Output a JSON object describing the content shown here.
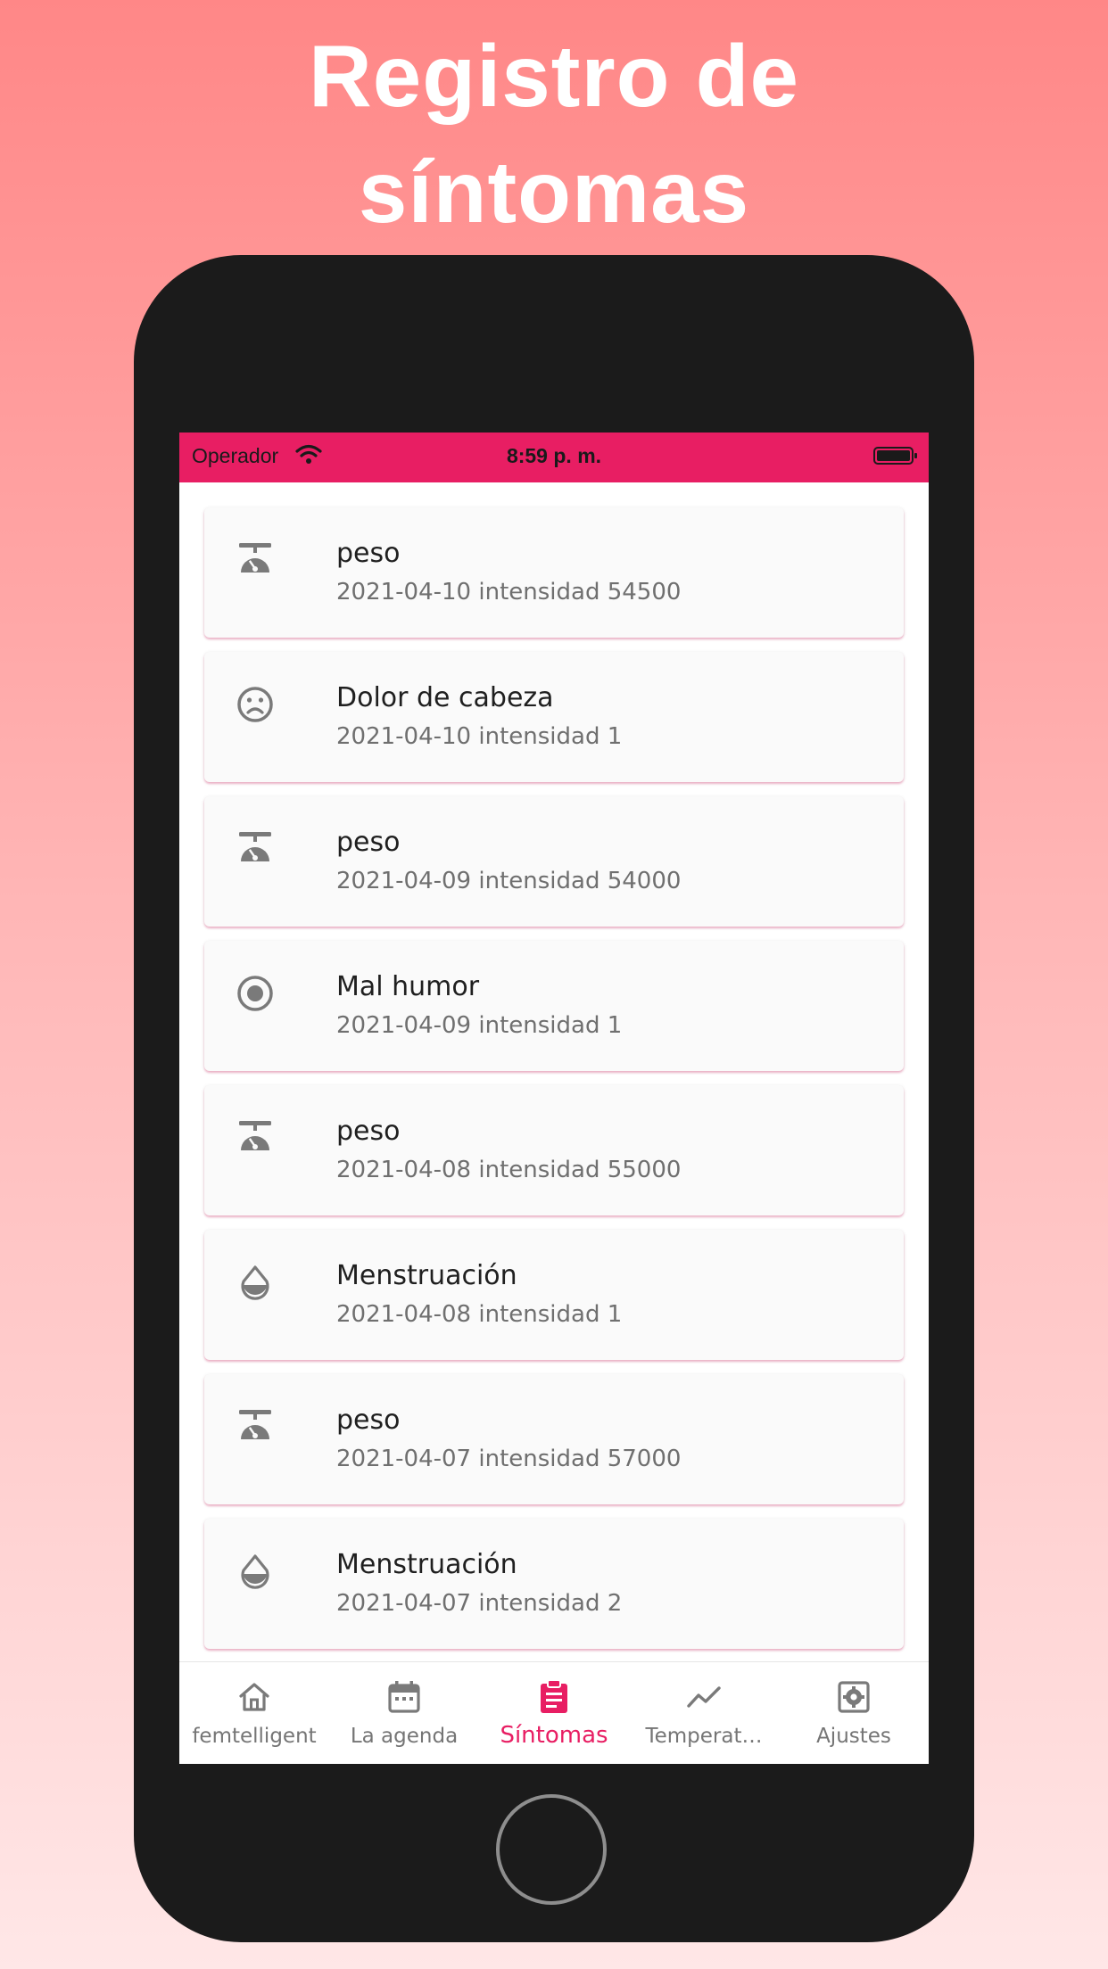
{
  "headline": {
    "line1": "Registro de",
    "line2": "síntomas"
  },
  "status_bar": {
    "carrier": "Operador",
    "time": "8:59 p. m."
  },
  "symptoms": [
    {
      "icon": "scale-icon",
      "title": "peso",
      "subtitle": "2021-04-10 intensidad 54500"
    },
    {
      "icon": "sad-face-icon",
      "title": "Dolor de cabeza",
      "subtitle": "2021-04-10 intensidad 1"
    },
    {
      "icon": "scale-icon",
      "title": "peso",
      "subtitle": "2021-04-09 intensidad 54000"
    },
    {
      "icon": "radio-dot-icon",
      "title": "Mal humor",
      "subtitle": "2021-04-09 intensidad 1"
    },
    {
      "icon": "scale-icon",
      "title": "peso",
      "subtitle": "2021-04-08 intensidad 55000"
    },
    {
      "icon": "drop-icon",
      "title": "Menstruación",
      "subtitle": "2021-04-08 intensidad 1"
    },
    {
      "icon": "scale-icon",
      "title": "peso",
      "subtitle": "2021-04-07 intensidad 57000"
    },
    {
      "icon": "drop-icon",
      "title": "Menstruación",
      "subtitle": "2021-04-07 intensidad 2"
    }
  ],
  "tabs": [
    {
      "label": "femtelligent",
      "icon": "home-icon",
      "active": false
    },
    {
      "label": "La agenda",
      "icon": "calendar-icon",
      "active": false
    },
    {
      "label": "Síntomas",
      "icon": "clipboard-icon",
      "active": true
    },
    {
      "label": "Temperat…",
      "icon": "trend-line-icon",
      "active": false
    },
    {
      "label": "Ajustes",
      "icon": "settings-icon",
      "active": false
    }
  ],
  "colors": {
    "accent": "#e81e63",
    "icon_gray": "#7a7a7a",
    "phone_body": "#1b1b1b",
    "background_top": "#ff8787",
    "background_bottom": "#ffe7e7"
  }
}
